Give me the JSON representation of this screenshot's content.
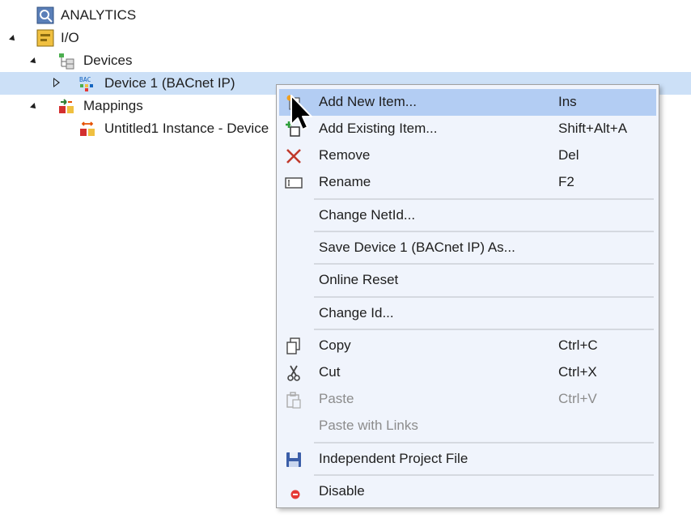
{
  "tree": {
    "items": [
      {
        "label": "ANALYTICS",
        "icon": "analytics-icon"
      },
      {
        "label": "I/O",
        "icon": "io-icon"
      },
      {
        "label": "Devices",
        "icon": "devices-icon"
      },
      {
        "label": "Device 1 (BACnet IP)",
        "icon": "bacnet-device-icon",
        "icon_text": "BAC"
      },
      {
        "label": "Mappings",
        "icon": "mappings-icon"
      },
      {
        "label": "Untitled1 Instance - Device",
        "icon": "mapping-instance-icon"
      }
    ]
  },
  "context_menu": {
    "items": [
      {
        "label": "Add New Item...",
        "shortcut": "Ins",
        "icon": "add-new-item-icon"
      },
      {
        "label": "Add Existing Item...",
        "shortcut": "Shift+Alt+A",
        "icon": "add-existing-item-icon"
      },
      {
        "label": "Remove",
        "shortcut": "Del",
        "icon": "remove-icon"
      },
      {
        "label": "Rename",
        "shortcut": "F2",
        "icon": "rename-icon"
      },
      {
        "label": "Change NetId...",
        "shortcut": ""
      },
      {
        "label": "Save Device 1 (BACnet IP) As...",
        "shortcut": ""
      },
      {
        "label": "Online Reset",
        "shortcut": ""
      },
      {
        "label": "Change Id...",
        "shortcut": ""
      },
      {
        "label": "Copy",
        "shortcut": "Ctrl+C",
        "icon": "copy-icon"
      },
      {
        "label": "Cut",
        "shortcut": "Ctrl+X",
        "icon": "cut-icon"
      },
      {
        "label": "Paste",
        "shortcut": "Ctrl+V",
        "icon": "paste-icon",
        "disabled": true
      },
      {
        "label": "Paste with Links",
        "shortcut": "",
        "disabled": true
      },
      {
        "label": "Independent Project File",
        "shortcut": "",
        "icon": "save-disk-icon"
      },
      {
        "label": "Disable",
        "shortcut": "",
        "icon": "disable-icon"
      }
    ]
  },
  "colors": {
    "selection": "#cce0f7",
    "menu_background": "#f0f4fc",
    "menu_highlight": "#b3cdf3",
    "disabled_text": "#8c8c8c",
    "remove_red": "#c0392b"
  }
}
